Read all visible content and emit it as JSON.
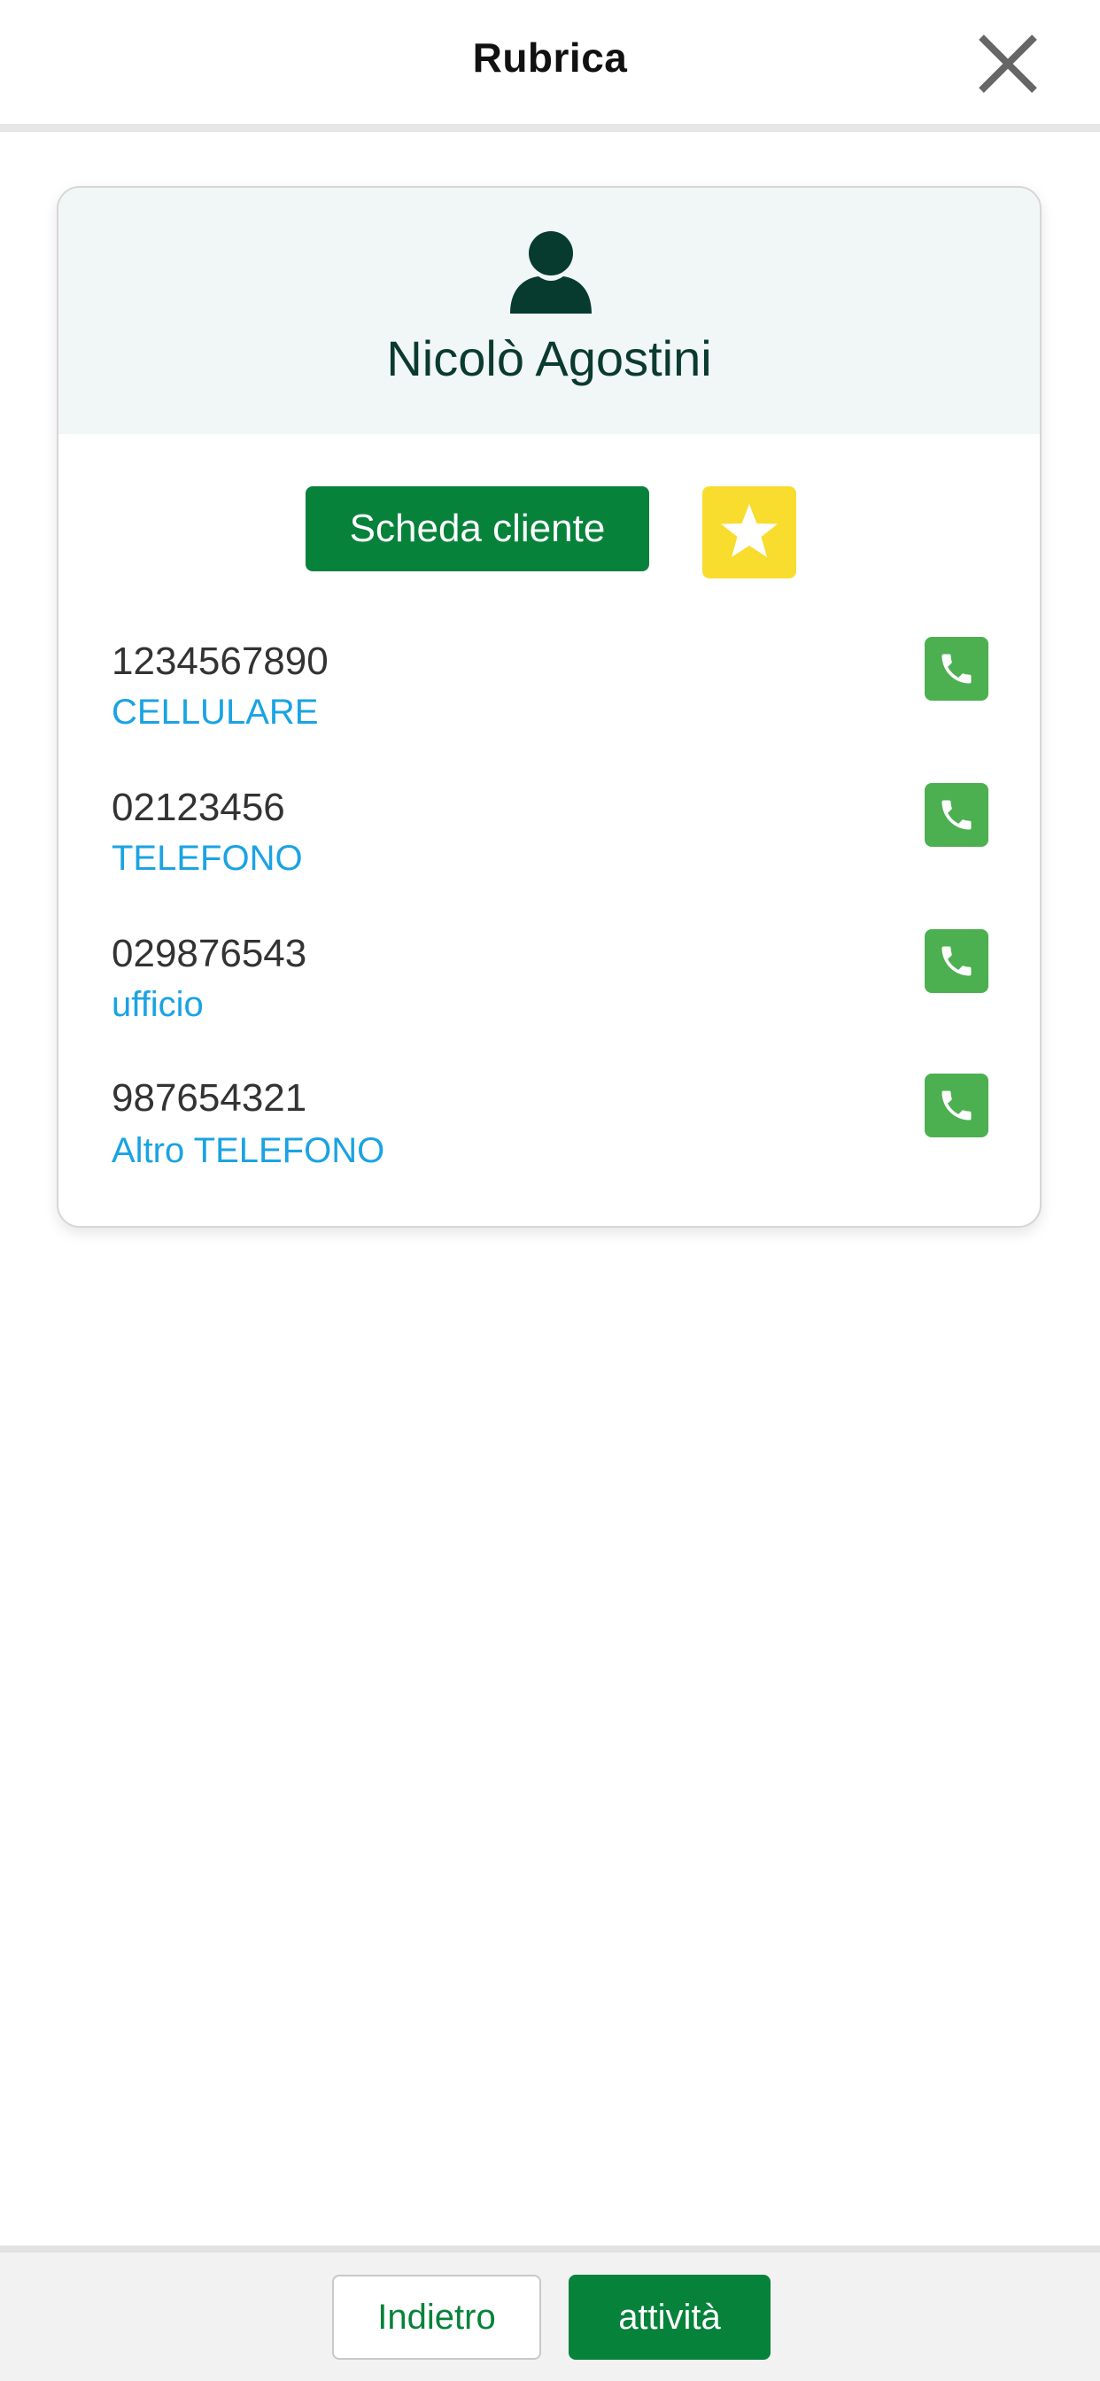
{
  "header": {
    "title": "Rubrica"
  },
  "contact": {
    "name": "Nicolò Agostini",
    "scheda_label": "Scheda cliente"
  },
  "phones": [
    {
      "number": "1234567890",
      "type": "CELLULARE"
    },
    {
      "number": "02123456",
      "type": "TELEFONO"
    },
    {
      "number": "029876543",
      "type": "ufficio"
    },
    {
      "number": "987654321",
      "type": "Altro TELEFONO"
    }
  ],
  "footer": {
    "back_label": "Indietro",
    "activity_label": "attività"
  },
  "colors": {
    "primary_green": "#07823b",
    "call_green": "#4caf50",
    "favorite_yellow": "#f8dc2e",
    "link_blue": "#1aa3e3",
    "name_dark": "#0b3a2e"
  },
  "icons": {
    "close": "close-icon",
    "person": "person-icon",
    "star": "star-icon",
    "phone": "phone-icon"
  }
}
